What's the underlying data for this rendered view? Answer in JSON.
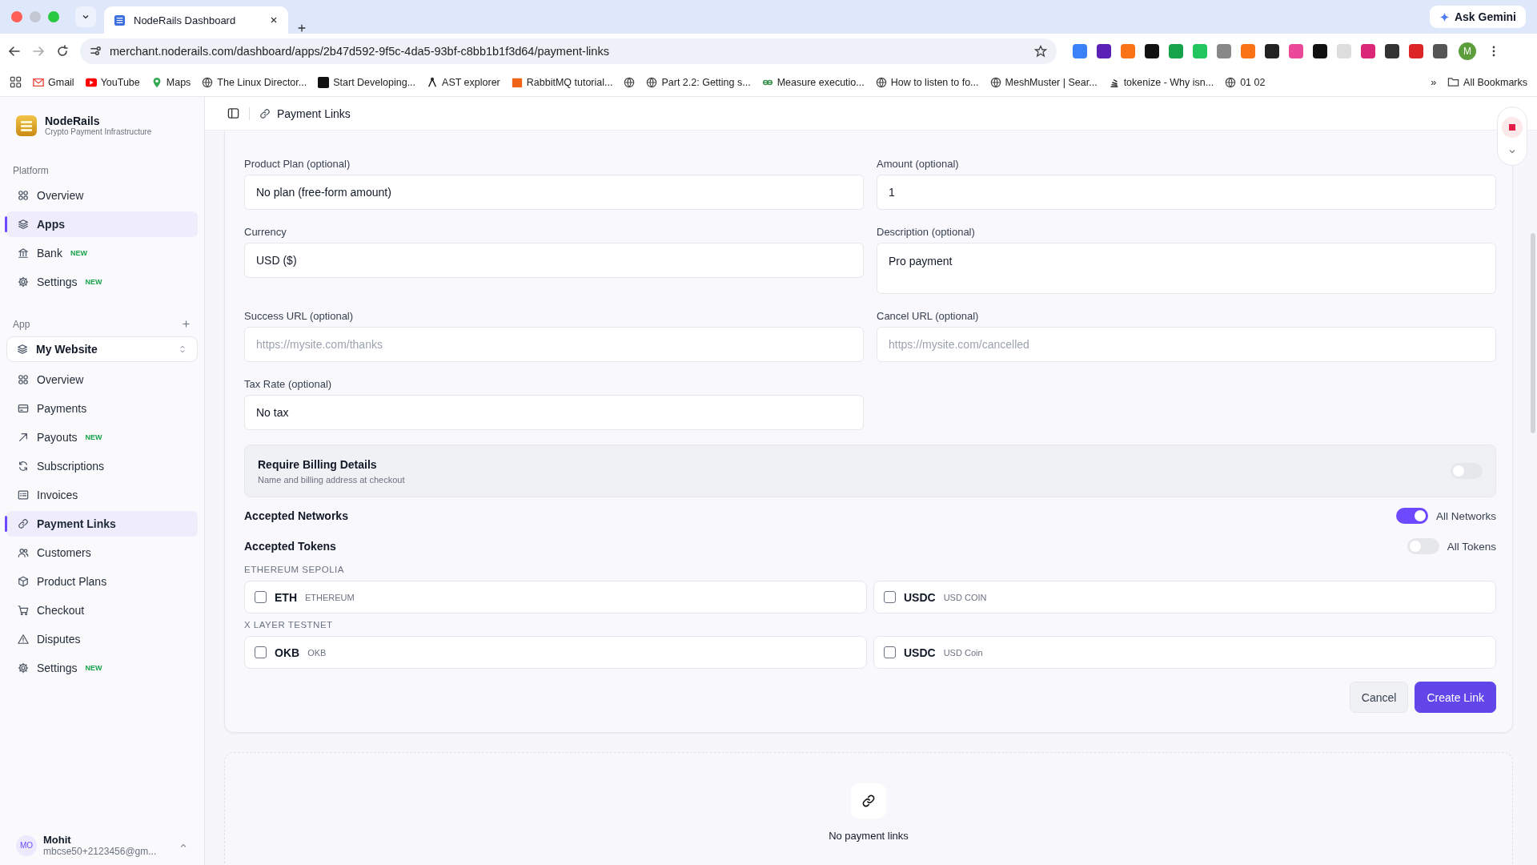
{
  "browser": {
    "tab_title": "NodeRails Dashboard",
    "url": "merchant.noderails.com/dashboard/apps/2b47d592-9f5c-4da5-93bf-c8bb1b1f3d64/payment-links",
    "ask": "Ask Gemini",
    "profile": "M",
    "all_bookmarks": "All Bookmarks",
    "more_bookmarks": "»",
    "bookmarks": [
      {
        "label": "Gmail"
      },
      {
        "label": "YouTube"
      },
      {
        "label": "Maps"
      },
      {
        "label": "The Linux Director..."
      },
      {
        "label": "Start Developing..."
      },
      {
        "label": "AST explorer"
      },
      {
        "label": "RabbitMQ tutorial..."
      },
      {
        "label": "Part 2.2: Getting s..."
      },
      {
        "label": "Measure executio..."
      },
      {
        "label": "How to listen to fo..."
      },
      {
        "label": "MeshMuster | Sear..."
      },
      {
        "label": "tokenize - Why isn..."
      },
      {
        "label": "01 02"
      }
    ]
  },
  "sidebar": {
    "brand": "NodeRails",
    "tagline": "Crypto Payment Infrastructure",
    "platform_heading": "Platform",
    "platform_items": [
      {
        "label": "Overview",
        "selected": false
      },
      {
        "label": "Apps",
        "selected": true
      },
      {
        "label": "Bank",
        "badge": "NEW",
        "selected": false
      },
      {
        "label": "Settings",
        "badge": "NEW",
        "selected": false
      }
    ],
    "app_heading": "App",
    "app_selector": "My Website",
    "app_items": [
      {
        "label": "Overview",
        "selected": false
      },
      {
        "label": "Payments",
        "selected": false
      },
      {
        "label": "Payouts",
        "badge": "NEW",
        "selected": false
      },
      {
        "label": "Subscriptions",
        "selected": false
      },
      {
        "label": "Invoices",
        "selected": false
      },
      {
        "label": "Payment Links",
        "selected": true
      },
      {
        "label": "Customers",
        "selected": false
      },
      {
        "label": "Product Plans",
        "selected": false
      },
      {
        "label": "Checkout",
        "selected": false
      },
      {
        "label": "Disputes",
        "selected": false
      },
      {
        "label": "Settings",
        "badge": "NEW",
        "selected": false
      }
    ],
    "user": {
      "initials": "MO",
      "name": "Mohit",
      "email": "mbcse50+2123456@gm..."
    }
  },
  "header": {
    "title": "Payment Links"
  },
  "form": {
    "fields": [
      {
        "label": "Product Plan (optional)",
        "value": "No plan (free-form amount)"
      },
      {
        "label": "Amount (optional)",
        "value": "1"
      },
      {
        "label": "Currency",
        "value": "USD ($)"
      },
      {
        "label": "Description (optional)",
        "value": "Pro payment",
        "kind": "textarea"
      },
      {
        "label": "Success URL (optional)",
        "placeholder": "https://mysite.com/thanks"
      },
      {
        "label": "Cancel URL (optional)",
        "placeholder": "https://mysite.com/cancelled"
      },
      {
        "label": "Tax Rate (optional)",
        "value": "No tax"
      }
    ],
    "billing": {
      "title": "Require Billing Details",
      "subtitle": "Name and billing address at checkout",
      "on": false
    },
    "networks": {
      "label": "Accepted Networks",
      "toggle_label": "All Networks",
      "on": true
    },
    "tokens": {
      "label": "Accepted Tokens",
      "toggle_label": "All Tokens",
      "on": false
    },
    "groups": [
      {
        "name": "ETHEREUM SEPOLIA",
        "tokens": [
          {
            "symbol": "ETH",
            "name": "ETHEREUM",
            "checked": false
          },
          {
            "symbol": "USDC",
            "name": "USD COIN",
            "checked": false
          }
        ]
      },
      {
        "name": "X LAYER TESTNET",
        "tokens": [
          {
            "symbol": "OKB",
            "name": "OKB",
            "checked": false
          },
          {
            "symbol": "USDC",
            "name": "USD Coin",
            "checked": false
          }
        ]
      }
    ],
    "buttons": {
      "cancel": "Cancel",
      "create": "Create Link"
    }
  },
  "empty": {
    "text": "No payment links"
  }
}
